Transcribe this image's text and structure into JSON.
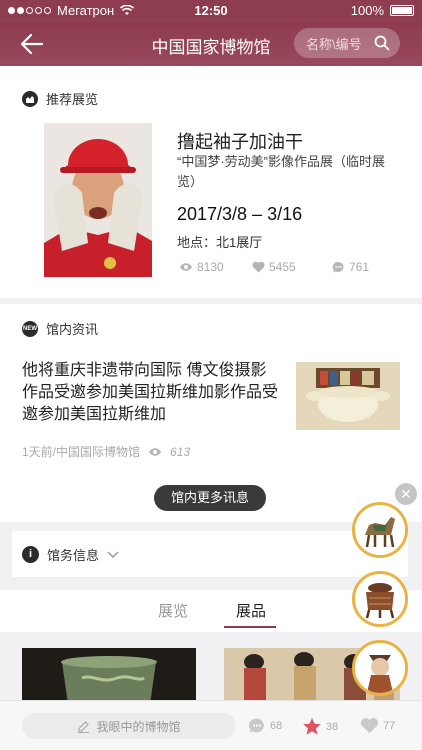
{
  "status_bar": {
    "carrier": "Мегатрон",
    "time": "12:50",
    "battery": "100%"
  },
  "nav": {
    "title": "中国国家博物馆",
    "search_placeholder": "名称\\编号"
  },
  "recommended": {
    "section_label": "推荐展览",
    "title": "撸起袖子加油干",
    "subtitle": "“中国梦·劳动美”影像作品展（临时展览）",
    "date": "2017/3/8 – 3/16",
    "location": "地点：北1展厅",
    "views": "8130",
    "likes": "5455",
    "comments": "761"
  },
  "news": {
    "section_label": "馆内资讯",
    "badge": "NEW",
    "headline": "他将重庆非遗带向国际 傅文俊摄影作品受邀参加美国拉斯维加影作品受邀参加美国拉斯维加",
    "meta": "1天前/中国国际博物馆",
    "views": "613",
    "more_button": "馆内更多讯息"
  },
  "museum_info": {
    "label": "馆务信息"
  },
  "tabs": [
    {
      "label": "展览"
    },
    {
      "label": "展品"
    }
  ],
  "bottom_bar": {
    "comment_placeholder": "我眼中的博物馆",
    "comments": "68",
    "favorites": "38",
    "likes": "77"
  },
  "colors": {
    "brand": "#8e3c50",
    "accent_ring": "#e9b342",
    "favorite": "#e0525f"
  },
  "icons": [
    "back-arrow-icon",
    "search-icon",
    "eye-icon",
    "heart-icon",
    "comment-icon",
    "star-icon",
    "edit-icon",
    "info-icon",
    "chevron-down-icon",
    "close-icon"
  ]
}
